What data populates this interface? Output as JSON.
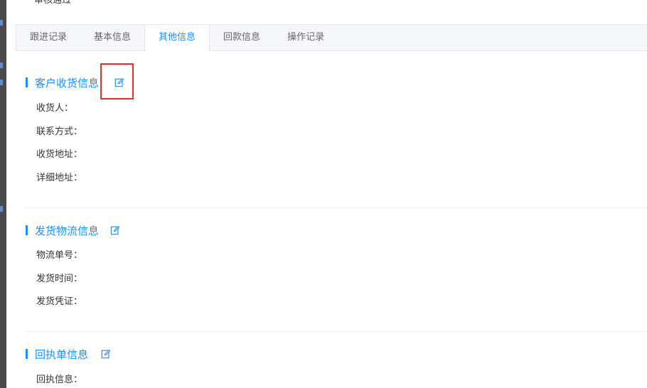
{
  "top_status": "审核通过",
  "tabs": [
    {
      "label": "跟进记录"
    },
    {
      "label": "基本信息"
    },
    {
      "label": "其他信息"
    },
    {
      "label": "回款信息"
    },
    {
      "label": "操作记录"
    }
  ],
  "active_tab": "其他信息",
  "sections": {
    "receiving": {
      "title": "客户收货信息",
      "fields": [
        "收货人：",
        "联系方式：",
        "收货地址：",
        "详细地址："
      ]
    },
    "logistics": {
      "title": "发货物流信息",
      "fields": [
        "物流单号：",
        "发货时间：",
        "发货凭证："
      ]
    },
    "receipt": {
      "title": "回执单信息",
      "fields": [
        "回执信息："
      ]
    }
  },
  "colors": {
    "accent": "#1890ff",
    "highlight": "#e8302a"
  },
  "icons": {
    "edit": "edit-icon"
  }
}
